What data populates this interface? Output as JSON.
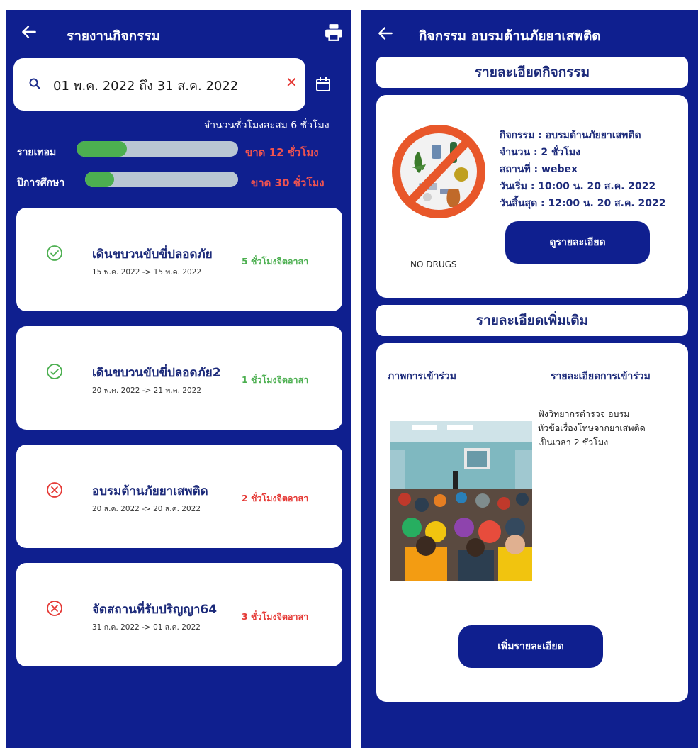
{
  "left": {
    "title": "รายงานกิจกรรม",
    "search": {
      "value": "01 พ.ค. 2022 ถึง 31 ส.ค. 2022"
    },
    "accumulated": "จำนวนชั่วโมงสะสม 6 ชั่วโมง",
    "progress": [
      {
        "label": "รายเทอม",
        "fill": 0.31,
        "lack": "ขาด 12 ชั่วโมง"
      },
      {
        "label": "ปีการศึกษา",
        "fill": 0.19,
        "lack": "ขาด 30 ชั่วโมง"
      }
    ],
    "activities": [
      {
        "title": "เดินขบวนขับขี่ปลอดภัย",
        "dates": "15 พ.ค. 2022 -> 15 พ.ค. 2022",
        "hours": "5 ชั่วโมงจิตอาสา",
        "status": "approved"
      },
      {
        "title": "เดินขบวนขับขี่ปลอดภัย2",
        "dates": "20 พ.ค. 2022 -> 21 พ.ค. 2022",
        "hours": "1 ชั่วโมงจิตอาสา",
        "status": "approved"
      },
      {
        "title": "อบรมต้านภัยยาเสพติด",
        "dates": "20 ส.ค. 2022 -> 20 ส.ค. 2022",
        "hours": "2 ชั่วโมงจิตอาสา",
        "status": "rejected"
      },
      {
        "title": "จัดสถานที่รับปริญญา64",
        "dates": "31 ก.ค. 2022 -> 01 ส.ค. 2022",
        "hours": "3 ชั่วโมงจิตอาสา",
        "status": "rejected"
      }
    ]
  },
  "right": {
    "title": "กิจกรรม อบรมต้านภัยยาเสพติด",
    "detail_header": "รายละเอียดกิจกรรม",
    "image_caption": "NO DRUGS",
    "info": [
      "กิจกรรม : อบรมต้านภัยยาเสพติด",
      "จำนวน : 2 ชั่วโมง",
      "สถานที่ : webex",
      "วันเริ่ม : 10:00 น. 20 ส.ค. 2022",
      "วันสิ้นสุด : 12:00 น. 20 ส.ค. 2022"
    ],
    "view_details_button": "ดูรายละเอียด",
    "more_header": "รายละเอียดเพิ่มเติม",
    "col_photo": "ภาพการเข้าร่วม",
    "col_detail": "รายละเอียดการเข้าร่วม",
    "participation_detail": [
      "ฟังวิทยากรตำรวจ อบรม",
      "หัวข้อเรื่องโทษจากยาเสพติด",
      "เป็นเวลา 2 ชั่วโมง"
    ],
    "add_details_button": "เพิ่มรายละเอียด"
  },
  "colors": {
    "navy": "#0f1f8f",
    "green": "#4caf50",
    "red": "#e53935",
    "title_text": "#1c2a7a"
  }
}
